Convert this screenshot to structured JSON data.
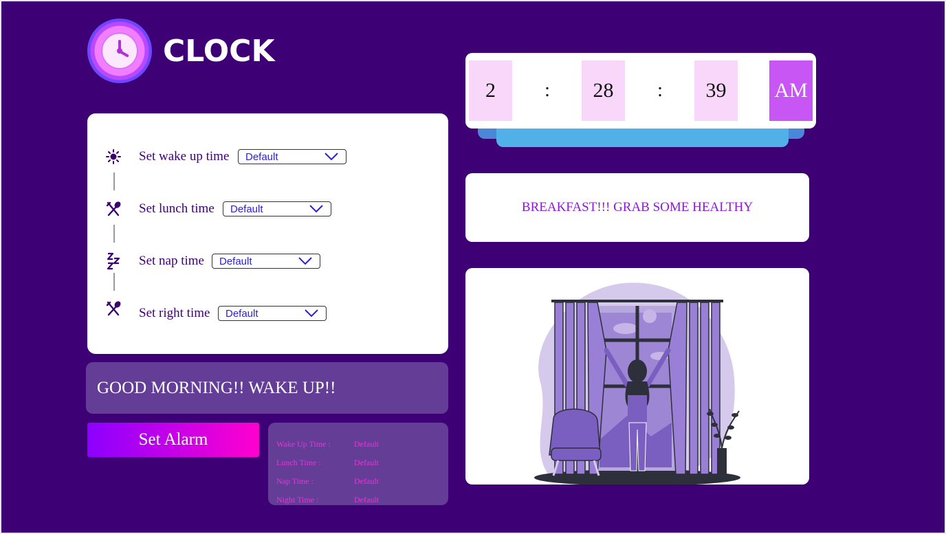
{
  "app": {
    "title": "CLOCK"
  },
  "clock": {
    "hours": "2",
    "minutes": "28",
    "seconds": "39",
    "ampm": "AM",
    "separator": ":"
  },
  "schedule": {
    "rows": [
      {
        "label": "Set wake up time",
        "value": "Default",
        "icon": "sun-icon"
      },
      {
        "label": "Set lunch time",
        "value": "Default",
        "icon": "utensils-icon"
      },
      {
        "label": "Set nap time",
        "value": "Default",
        "icon": "sleep-zzz-icon"
      },
      {
        "label": "Set right time",
        "value": "Default",
        "icon": "utensils-icon"
      }
    ]
  },
  "greeting": "GOOD MORNING!! WAKE UP!!",
  "message": "BREAKFAST!!! GRAB SOME HEALTHY",
  "alarm_button": "Set Alarm",
  "summary": {
    "rows": [
      {
        "label": "Wake Up Time :",
        "value": "Default"
      },
      {
        "label": "Lunch Time :",
        "value": "Default"
      },
      {
        "label": "Nap Time :",
        "value": "Default"
      },
      {
        "label": "Night Time :",
        "value": "Default"
      }
    ]
  },
  "colors": {
    "background": "#3d0075",
    "accent_pink": "#f8d7fa",
    "accent_purple": "#c856f4",
    "panel_purple": "#633d96",
    "message_text": "#8a1ad6"
  }
}
